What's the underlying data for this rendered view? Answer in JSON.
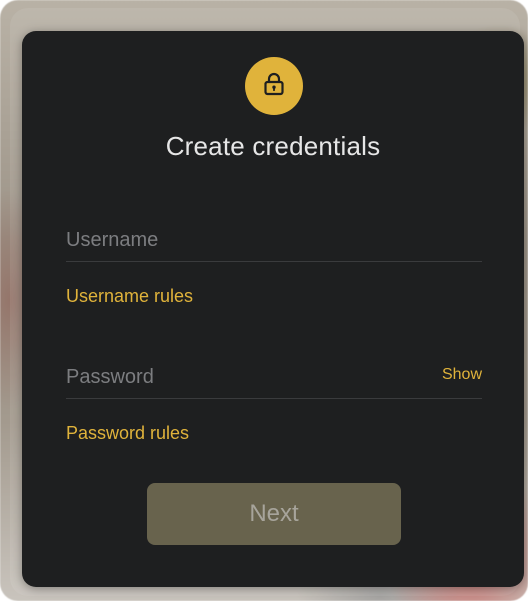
{
  "colors": {
    "accent": "#e0b33b",
    "card_background": "#1e1f20",
    "button_disabled": "#68634d"
  },
  "header": {
    "icon": "lock-icon",
    "title": "Create credentials"
  },
  "username": {
    "value": "",
    "placeholder": "Username",
    "rules_link": "Username rules"
  },
  "password": {
    "value": "",
    "placeholder": "Password",
    "show_label": "Show",
    "rules_link": "Password rules"
  },
  "actions": {
    "next_label": "Next"
  }
}
